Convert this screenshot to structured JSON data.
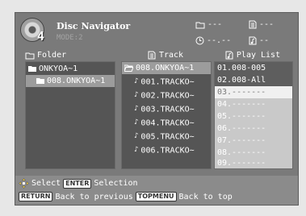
{
  "header": {
    "disc_number": "4",
    "title": "Disc Navigator",
    "mode": "MODE:2"
  },
  "status": {
    "folder_value": "---",
    "file_value": "---",
    "time_value": "--.--",
    "track_value": "--"
  },
  "folder_panel": {
    "label": "Folder",
    "items": [
      {
        "label": "ONKYOA~1"
      },
      {
        "label": "008.ONKYOA~1"
      }
    ]
  },
  "track_panel": {
    "label": "Track",
    "folder": "008.ONKYOA~1",
    "items": [
      {
        "label": "001.TRACKO~"
      },
      {
        "label": "002.TRACKO~"
      },
      {
        "label": "003.TRACKO~"
      },
      {
        "label": "004.TRACKO~"
      },
      {
        "label": "005.TRACKO~"
      },
      {
        "label": "006.TRACKO~"
      }
    ]
  },
  "playlist_panel": {
    "label": "Play List",
    "items": [
      {
        "label": "01.008-005"
      },
      {
        "label": "02.008-All"
      },
      {
        "label": "03.-------"
      },
      {
        "label": "04.-------"
      },
      {
        "label": "05.-------"
      },
      {
        "label": "06.-------"
      },
      {
        "label": "07.-------"
      },
      {
        "label": "08.-------"
      },
      {
        "label": "09.-------"
      }
    ]
  },
  "footer": {
    "select_text": "Select",
    "enter_key": "ENTER",
    "selection_text": "Selection",
    "return_key": "RETURN",
    "back_text": "Back to previous",
    "topmenu_key": "TOPMENU",
    "top_text": "Back to top"
  },
  "colors": {
    "screen_bg": "#7a7a7a",
    "panel_bg": "#555555",
    "highlight": "#9c9c9c",
    "playlist_bg": "#c9c9c9",
    "footer_bg": "#8b8b8b"
  }
}
